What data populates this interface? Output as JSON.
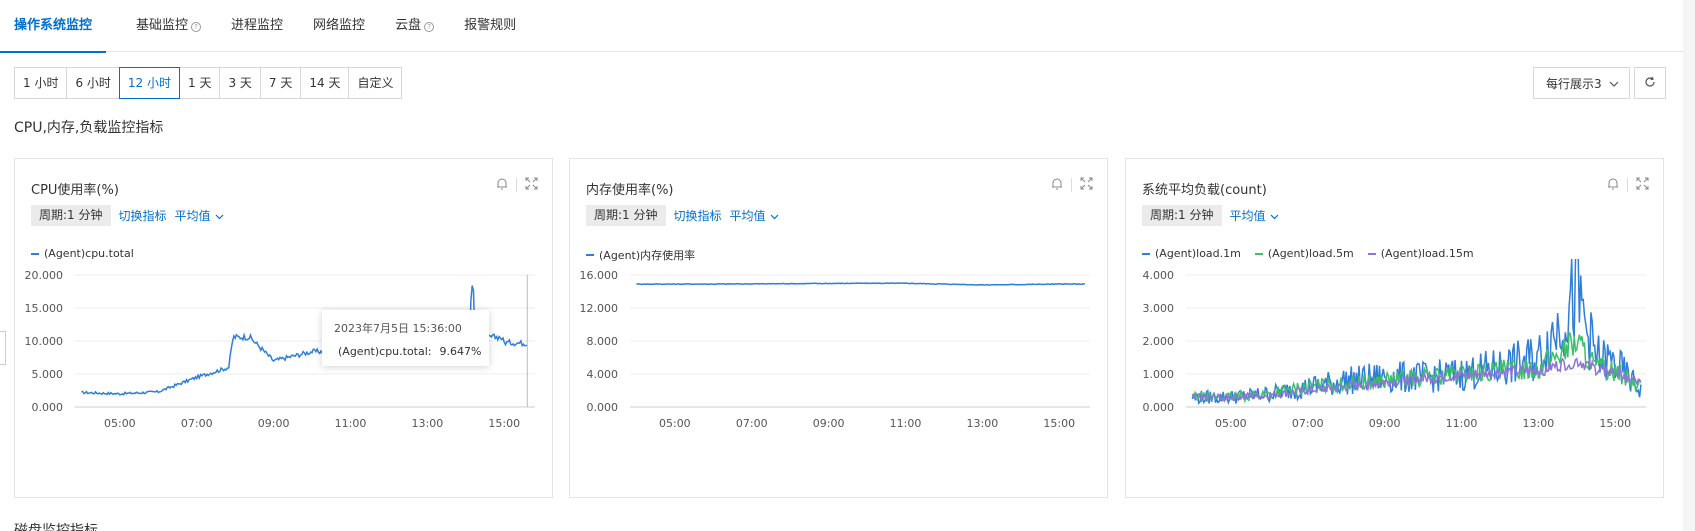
{
  "tabs": [
    {
      "label": "操作系统监控",
      "active": true,
      "help": false
    },
    {
      "label": "基础监控",
      "active": false,
      "help": true
    },
    {
      "label": "进程监控",
      "active": false,
      "help": false
    },
    {
      "label": "网络监控",
      "active": false,
      "help": false
    },
    {
      "label": "云盘",
      "active": false,
      "help": true
    },
    {
      "label": "报警规则",
      "active": false,
      "help": false
    }
  ],
  "time_ranges": [
    "1 小时",
    "6 小时",
    "12 小时",
    "1 天",
    "3 天",
    "7 天",
    "14 天",
    "自定义"
  ],
  "time_ranges_active": "12 小时",
  "per_row_select": "每行展示3",
  "section_title": "CPU,内存,负载监控指标",
  "section_title2": "磁盘监控指标",
  "colors": {
    "accent": "#0070cc",
    "series_blue": "#2f7ed8",
    "series_green": "#3cc06b",
    "series_purple": "#8c74d8"
  },
  "charts": [
    {
      "title": "CPU使用率(%)",
      "period": "周期:1 分钟",
      "switch_label": "切换指标",
      "agg_label": "平均值",
      "legend": [
        {
          "name": "(Agent)cpu.total",
          "color": "#2f7ed8"
        }
      ]
    },
    {
      "title": "内存使用率(%)",
      "period": "周期:1 分钟",
      "switch_label": "切换指标",
      "agg_label": "平均值",
      "legend": [
        {
          "name": "(Agent)内存使用率",
          "color": "#2f7ed8"
        }
      ]
    },
    {
      "title": "系统平均负载(count)",
      "period": "周期:1 分钟",
      "switch_label": "",
      "agg_label": "平均值",
      "legend": [
        {
          "name": "(Agent)load.1m",
          "color": "#2f7ed8"
        },
        {
          "name": "(Agent)load.5m",
          "color": "#3cc06b"
        },
        {
          "name": "(Agent)load.15m",
          "color": "#8c74d8"
        }
      ]
    }
  ],
  "tooltip": {
    "time": "2023年7月5日 15:36:00",
    "label": "(Agent)cpu.total:",
    "value": "9.647%"
  },
  "chart_data": [
    {
      "type": "line",
      "title": "CPU使用率(%)",
      "x": [
        "04:00",
        "05:00",
        "06:00",
        "07:00",
        "07:50",
        "08:00",
        "09:00",
        "10:00",
        "11:00",
        "12:00",
        "13:00",
        "14:00",
        "14:10",
        "15:00",
        "15:36"
      ],
      "x_ticks": [
        "05:00",
        "07:00",
        "09:00",
        "11:00",
        "13:00",
        "15:00"
      ],
      "y_ticks": [
        "0.000",
        "5.000",
        "10.000",
        "15.000",
        "20.000"
      ],
      "ylim": [
        0,
        20
      ],
      "series": [
        {
          "name": "(Agent)cpu.total",
          "values": [
            2.2,
            2.0,
            2.3,
            4.5,
            6.0,
            12.8,
            7.0,
            8.4,
            8.4,
            8.9,
            9.3,
            10.0,
            17.8,
            9.8,
            9.647
          ]
        }
      ]
    },
    {
      "type": "line",
      "title": "内存使用率(%)",
      "x": [
        "04:00",
        "06:00",
        "08:00",
        "10:00",
        "11:00",
        "12:00",
        "13:00",
        "14:00",
        "15:00",
        "15:40"
      ],
      "x_ticks": [
        "05:00",
        "07:00",
        "09:00",
        "11:00",
        "13:00",
        "15:00"
      ],
      "y_ticks": [
        "0.000",
        "4.000",
        "8.000",
        "12.000",
        "16.000"
      ],
      "ylim": [
        0,
        16
      ],
      "series": [
        {
          "name": "(Agent)内存使用率",
          "values": [
            14.9,
            14.9,
            14.95,
            15.0,
            15.0,
            14.9,
            14.8,
            14.85,
            14.9,
            14.9
          ]
        }
      ]
    },
    {
      "type": "line",
      "title": "系统平均负载(count)",
      "x": [
        "04:00",
        "05:00",
        "06:00",
        "07:00",
        "08:00",
        "09:00",
        "10:00",
        "11:00",
        "12:00",
        "13:00",
        "14:00",
        "14:30",
        "15:00",
        "15:40"
      ],
      "x_ticks": [
        "05:00",
        "07:00",
        "09:00",
        "11:00",
        "13:00",
        "15:00"
      ],
      "y_ticks": [
        "0.000",
        "1.000",
        "2.000",
        "3.000",
        "4.000"
      ],
      "ylim": [
        0,
        4
      ],
      "series": [
        {
          "name": "(Agent)load.1m",
          "values": [
            0.3,
            0.3,
            0.4,
            0.6,
            0.8,
            0.9,
            0.9,
            1.0,
            1.2,
            1.5,
            3.4,
            1.5,
            1.3,
            0.5
          ]
        },
        {
          "name": "(Agent)load.5m",
          "values": [
            0.3,
            0.3,
            0.4,
            0.6,
            0.7,
            0.8,
            0.9,
            1.0,
            1.1,
            1.2,
            2.0,
            1.2,
            1.1,
            0.6
          ]
        },
        {
          "name": "(Agent)load.15m",
          "values": [
            0.3,
            0.3,
            0.35,
            0.5,
            0.6,
            0.75,
            0.85,
            0.95,
            1.05,
            1.1,
            1.4,
            1.15,
            1.05,
            0.7
          ]
        }
      ]
    }
  ]
}
